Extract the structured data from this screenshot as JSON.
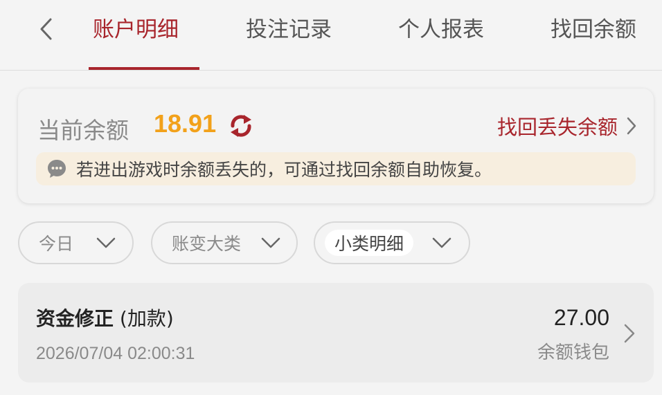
{
  "tabs": [
    {
      "label": "账户明细",
      "active": true
    },
    {
      "label": "投注记录",
      "active": false
    },
    {
      "label": "个人报表",
      "active": false
    },
    {
      "label": "找回余额",
      "active": false
    }
  ],
  "balance": {
    "label": "当前余额",
    "value": "18.91",
    "recover_link": "找回丢失余额",
    "notice": "若进出游戏时余额丢失的，可通过找回余额自助恢复。"
  },
  "filters": [
    {
      "label": "今日"
    },
    {
      "label": "账变大类"
    },
    {
      "label": "小类明细"
    }
  ],
  "records": [
    {
      "title": "资金修正",
      "subtitle": " (加款)",
      "time": "2026/07/04 02:00:31",
      "amount": "27.00",
      "wallet": "余额钱包"
    }
  ],
  "colors": {
    "accent": "#a8252c",
    "balance_value": "#f2a11a",
    "notice_bg": "#f7eedf"
  }
}
